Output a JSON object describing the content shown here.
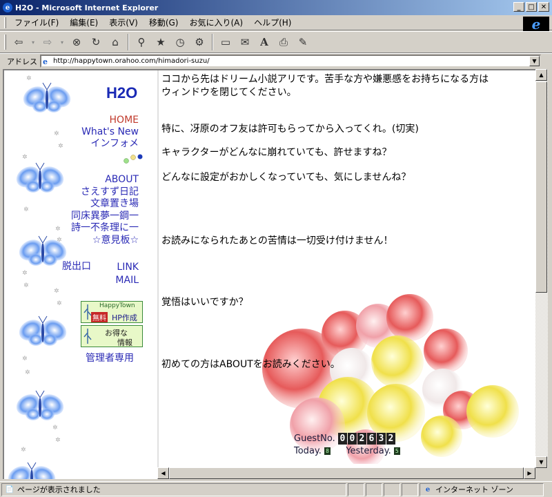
{
  "window": {
    "title": "H2O - Microsoft Internet Explorer"
  },
  "menu": [
    "ファイル(F)",
    "編集(E)",
    "表示(V)",
    "移動(G)",
    "お気に入り(A)",
    "ヘルプ(H)"
  ],
  "address": {
    "label": "アドレス",
    "url": "http://happytown.orahoo.com/himadori-suzu/"
  },
  "sidebar": {
    "logo": "H2O",
    "nav1": [
      "HOME",
      "What's New",
      "インフォメ"
    ],
    "nav2": [
      "ABOUT",
      "さえすず日記",
      "文章置き場",
      "同床異夢一鋼一",
      "詩一不条理に一",
      "☆意見板☆"
    ],
    "nav3_left": "脱出口",
    "nav3_right": [
      "LINK",
      "MAIL"
    ],
    "banner1": {
      "line1": "HappyTown",
      "badge": "無料",
      "line2": "HP作成"
    },
    "banner2": {
      "line1": "お得な",
      "line2": "情報"
    },
    "admin": "管理者専用"
  },
  "main": {
    "line1": "ココから先はドリーム小説アリです。苦手な方や嫌悪感をお持ちになる方は",
    "line2": "ウィンドウを閉じてください。",
    "line3": "特に、冴原のオフ友は許可もらってから入ってくれ。(切実)",
    "line4": "キャラクターがどんなに崩れていても、許せますね？",
    "line5": "どんなに設定がおかしくなっていても、気にしませんね？",
    "line6": "お読みになられたあとの苦情は一切受け付けません！",
    "line7": "覚悟はいいですか？",
    "line8": "初めての方はABOUTをお読みください。"
  },
  "counter": {
    "guest_label": "GuestNo.",
    "guest_digits": [
      "0",
      "0",
      "2",
      "6",
      "3",
      "2"
    ],
    "today_label": "Today.",
    "today_value": "8",
    "yesterday_label": "Yesterday.",
    "yesterday_value": "5"
  },
  "status": {
    "text": "ページが表示されました",
    "zone": "インターネット ゾーン"
  }
}
